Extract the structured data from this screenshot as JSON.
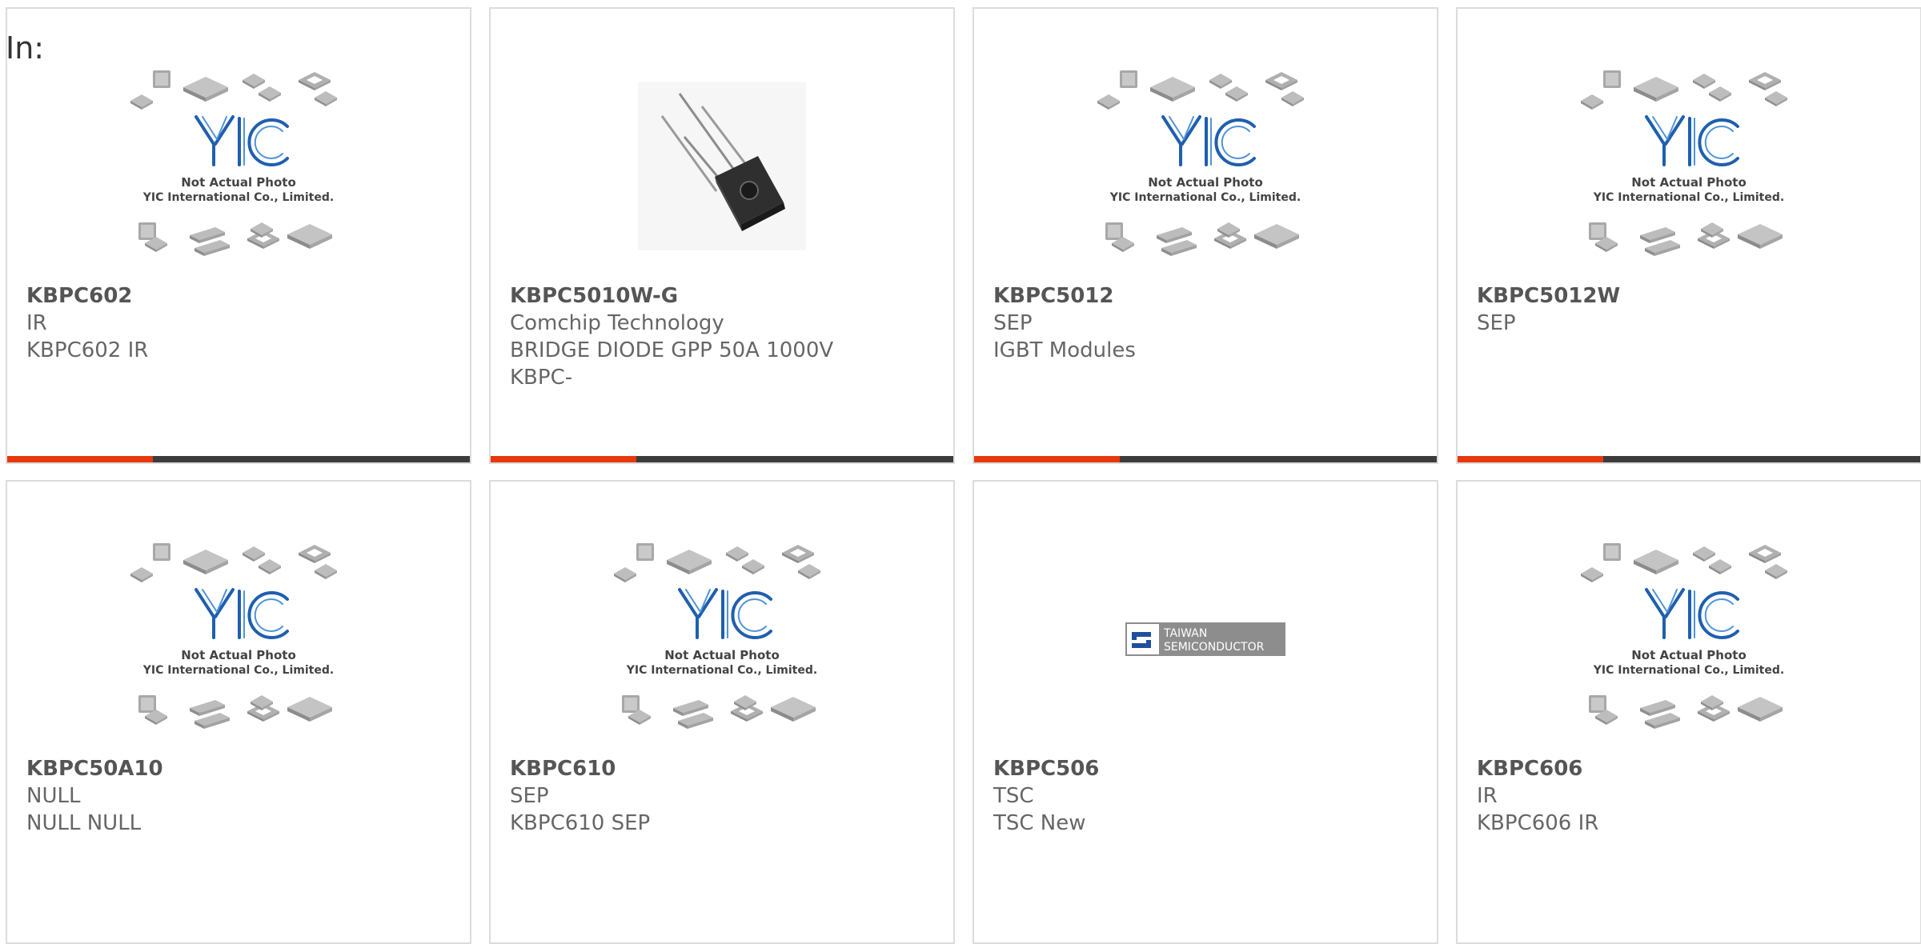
{
  "header": {
    "label": "In:"
  },
  "placeholder_image": {
    "brand": "YIC",
    "caption_line1": "Not Actual Photo",
    "caption_line2": "YIC International Co., Limited."
  },
  "tsc_logo": {
    "line1": "TAIWAN",
    "line2": "SEMICONDUCTOR"
  },
  "colors": {
    "accent": "#e8380d",
    "bar": "#3c3c3c",
    "border": "#dcdcdc",
    "text": "#666666",
    "yic_blue": "#1f5fae"
  },
  "products": [
    {
      "name": "KBPC602",
      "line1": "IR",
      "line2": "KBPC602 IR",
      "line3": "",
      "image": "yic-placeholder-image"
    },
    {
      "name": "KBPC5010W-G",
      "line1": "Comchip Technology",
      "line2": "BRIDGE DIODE GPP 50A 1000V",
      "line3": "KBPC-",
      "image": "bridge-rectifier-photo"
    },
    {
      "name": "KBPC5012",
      "line1": "SEP",
      "line2": "IGBT Modules",
      "line3": "",
      "image": "yic-placeholder-image"
    },
    {
      "name": "KBPC5012W",
      "line1": "SEP",
      "line2": "",
      "line3": "",
      "image": "yic-placeholder-image"
    },
    {
      "name": "KBPC50A10",
      "line1": "NULL",
      "line2": "NULL NULL",
      "line3": "",
      "image": "yic-placeholder-image"
    },
    {
      "name": "KBPC610",
      "line1": "SEP",
      "line2": "KBPC610 SEP",
      "line3": "",
      "image": "yic-placeholder-image"
    },
    {
      "name": "KBPC506",
      "line1": "TSC",
      "line2": "TSC New",
      "line3": "",
      "image": "taiwan-semiconductor-logo"
    },
    {
      "name": "KBPC606",
      "line1": "IR",
      "line2": "KBPC606 IR",
      "line3": "",
      "image": "yic-placeholder-image"
    }
  ]
}
